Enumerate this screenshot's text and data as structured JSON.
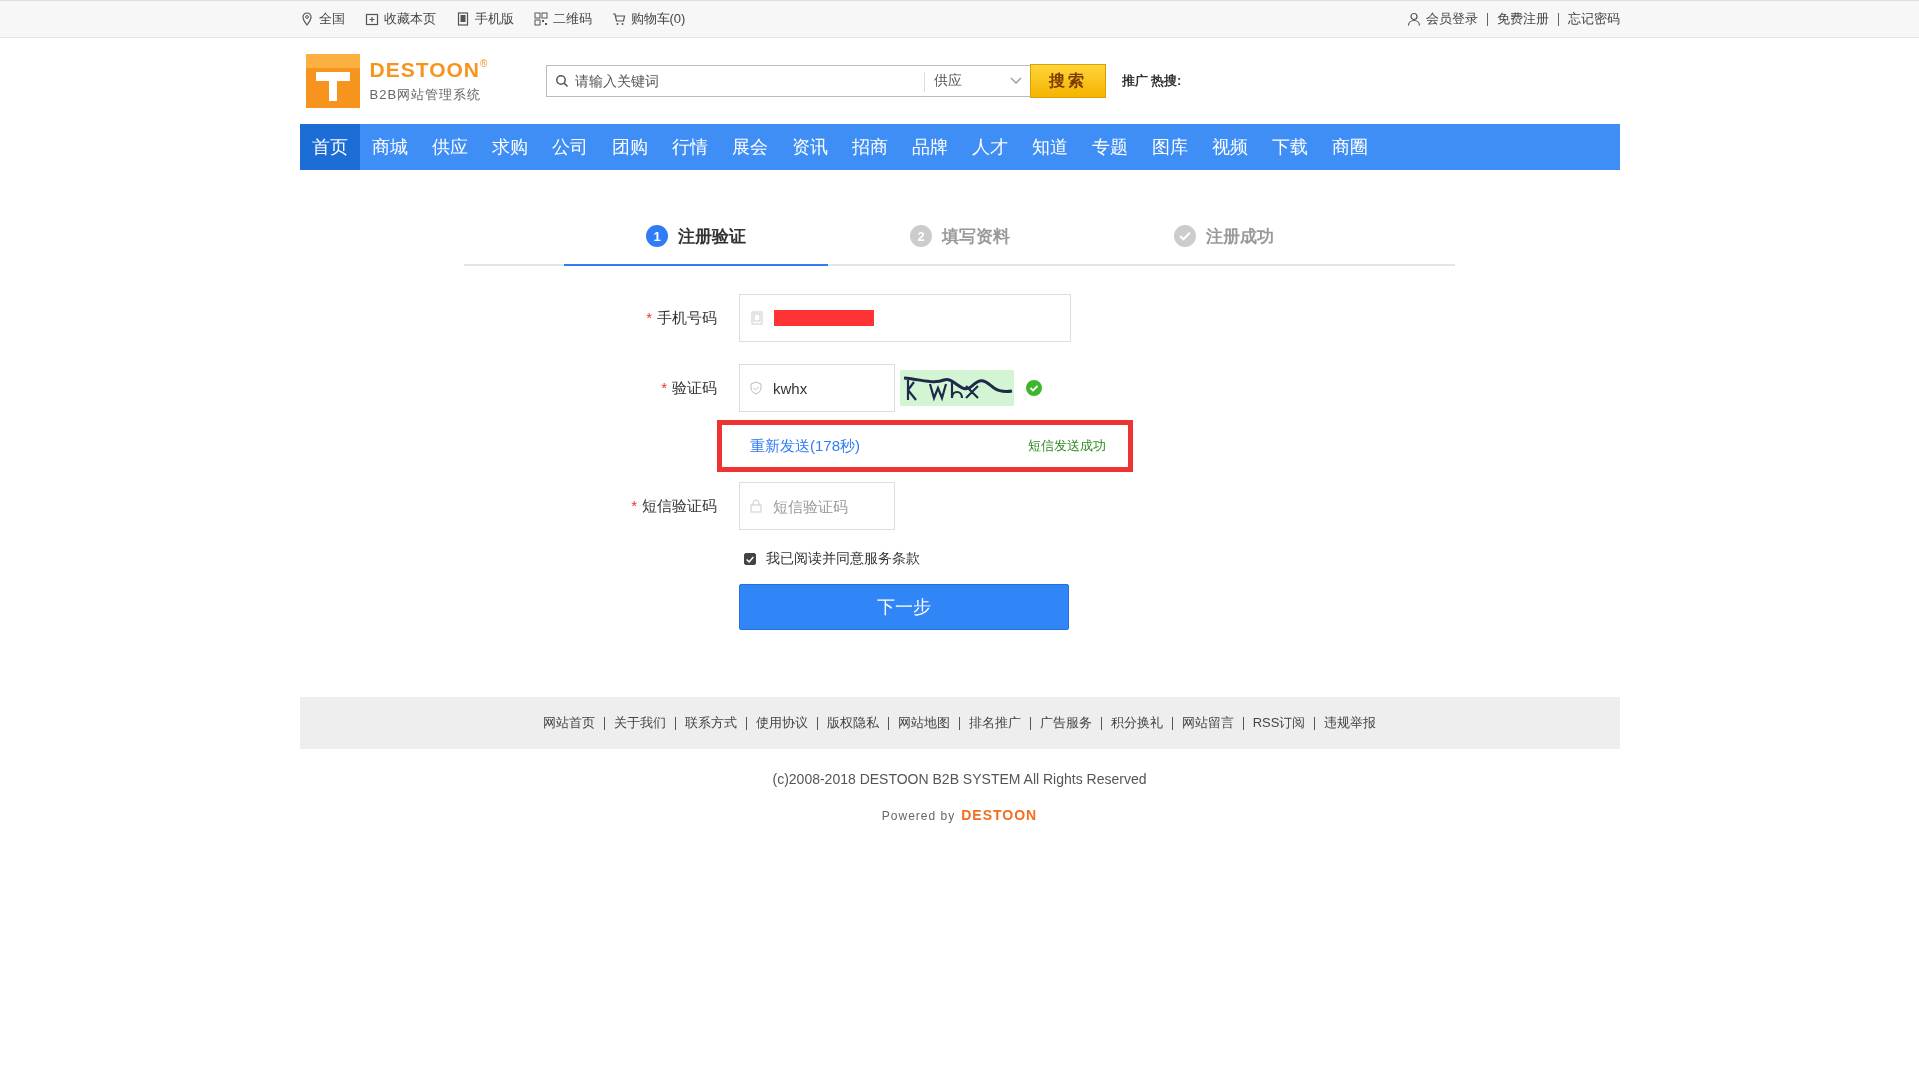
{
  "top_bar": {
    "left": [
      {
        "kind": "pin",
        "label": "全国"
      },
      {
        "kind": "bookmark",
        "label": "收藏本页"
      },
      {
        "kind": "mobile",
        "label": "手机版"
      },
      {
        "kind": "qr",
        "label": "二维码"
      },
      {
        "kind": "cart",
        "label": "购物车(0)"
      }
    ],
    "right": [
      {
        "kind": "user",
        "label": "会员登录"
      },
      {
        "kind": "link",
        "label": "免费注册"
      },
      {
        "kind": "link",
        "label": "忘记密码"
      }
    ]
  },
  "logo": {
    "name": "DESTOON",
    "mark": "®",
    "subtitle": "B2B网站管理系统"
  },
  "search": {
    "placeholder": "请输入关键词",
    "category": "供应",
    "button": "搜索",
    "hot_label": "推广 热搜:"
  },
  "nav": [
    {
      "label": "首页",
      "selected": true
    },
    {
      "label": "商城",
      "selected": false
    },
    {
      "label": "供应",
      "selected": false
    },
    {
      "label": "求购",
      "selected": false
    },
    {
      "label": "公司",
      "selected": false
    },
    {
      "label": "团购",
      "selected": false
    },
    {
      "label": "行情",
      "selected": false
    },
    {
      "label": "展会",
      "selected": false
    },
    {
      "label": "资讯",
      "selected": false
    },
    {
      "label": "招商",
      "selected": false
    },
    {
      "label": "品牌",
      "selected": false
    },
    {
      "label": "人才",
      "selected": false
    },
    {
      "label": "知道",
      "selected": false
    },
    {
      "label": "专题",
      "selected": false
    },
    {
      "label": "图库",
      "selected": false
    },
    {
      "label": "视频",
      "selected": false
    },
    {
      "label": "下载",
      "selected": false
    },
    {
      "label": "商圈",
      "selected": false
    }
  ],
  "steps": [
    {
      "kind": "number",
      "number": "1",
      "label": "注册验证",
      "selected": true
    },
    {
      "kind": "number",
      "number": "2",
      "label": "填写资料",
      "selected": false
    },
    {
      "kind": "check",
      "label": "注册成功",
      "selected": false
    }
  ],
  "form": {
    "phone": {
      "required_mark": "*",
      "label": "手机号码"
    },
    "captcha": {
      "required_mark": "*",
      "label": "验证码",
      "value": "kwhx",
      "verified": true
    },
    "resend": {
      "link": "重新发送(178秒)",
      "status": "短信发送成功"
    },
    "sms": {
      "required_mark": "*",
      "label": "短信验证码",
      "placeholder": "短信验证码"
    },
    "agree": {
      "label": "我已阅读并同意服务条款",
      "checked": true
    },
    "submit": "下一步"
  },
  "footer": {
    "links": [
      "网站首页",
      "关于我们",
      "联系方式",
      "使用协议",
      "版权隐私",
      "网站地图",
      "排名推广",
      "广告服务",
      "积分换礼",
      "网站留言",
      "RSS订阅",
      "违规举报"
    ],
    "copyright": "(c)2008-2018 DESTOON B2B SYSTEM All Rights Reserved",
    "powered": "Powered by",
    "powered_brand": "DESTOON"
  }
}
